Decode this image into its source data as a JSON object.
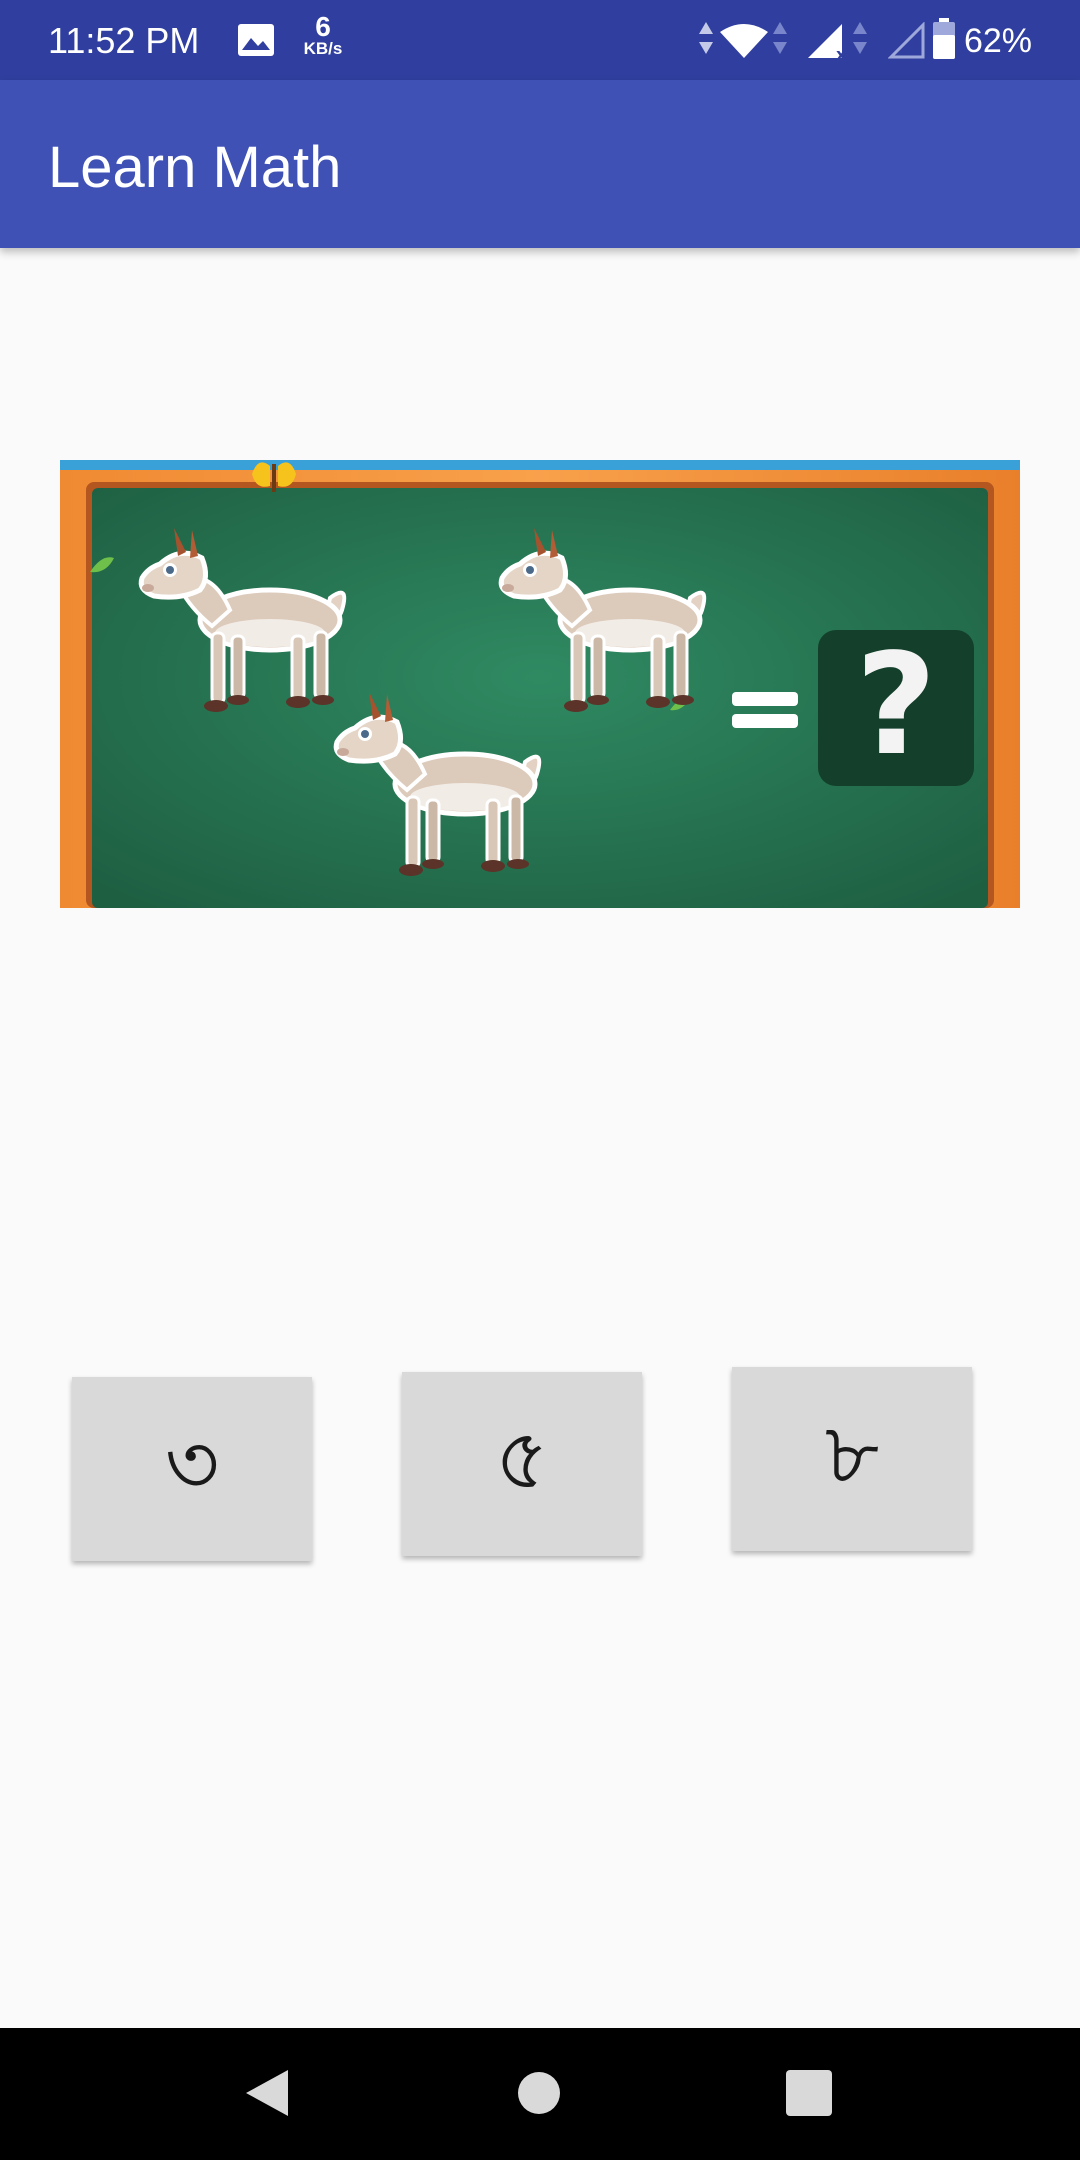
{
  "status_bar": {
    "time": "11:52 PM",
    "speed_value": "6",
    "speed_unit": "KB/s",
    "battery_percent": "62%",
    "icons": [
      "gallery-icon",
      "data-arrows-icon",
      "wifi-icon",
      "signal-no-data-icon",
      "signal-empty-icon",
      "battery-icon"
    ]
  },
  "app_bar": {
    "title": "Learn Math"
  },
  "question": {
    "image": "chalkboard-with-three-goats-equals-question-mark",
    "equals_sign": "=",
    "unknown": "?"
  },
  "answers": [
    {
      "label": "৩"
    },
    {
      "label": "৫"
    },
    {
      "label": "৮"
    }
  ],
  "nav_bar": {
    "icons": [
      "back-icon",
      "home-icon",
      "recent-apps-icon"
    ]
  },
  "colors": {
    "status_bar": "#303f9f",
    "app_bar": "#3f51b5",
    "background": "#fafafa",
    "button": "#d8d9d8",
    "board_green": "#2e7d5b",
    "board_frame": "#f5923e"
  }
}
